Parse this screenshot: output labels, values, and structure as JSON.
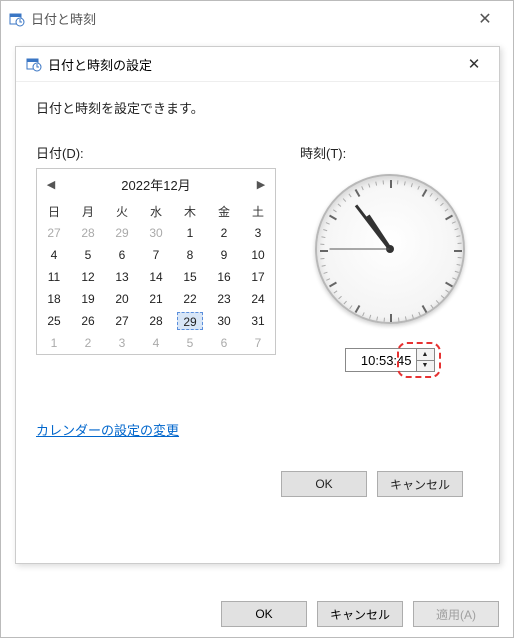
{
  "outer": {
    "title": "日付と時刻",
    "buttons": {
      "ok": "OK",
      "cancel": "キャンセル",
      "apply": "適用(A)"
    }
  },
  "inner": {
    "title": "日付と時刻の設定",
    "desc": "日付と時刻を設定できます。",
    "date_label": "日付(D):",
    "time_label": "時刻(T):",
    "calendar": {
      "month_title": "2022年12月",
      "weekdays": [
        "日",
        "月",
        "火",
        "水",
        "木",
        "金",
        "土"
      ],
      "weeks": [
        [
          {
            "d": 27,
            "o": true
          },
          {
            "d": 28,
            "o": true
          },
          {
            "d": 29,
            "o": true
          },
          {
            "d": 30,
            "o": true
          },
          {
            "d": 1
          },
          {
            "d": 2
          },
          {
            "d": 3
          }
        ],
        [
          {
            "d": 4
          },
          {
            "d": 5
          },
          {
            "d": 6
          },
          {
            "d": 7
          },
          {
            "d": 8
          },
          {
            "d": 9
          },
          {
            "d": 10
          }
        ],
        [
          {
            "d": 11
          },
          {
            "d": 12
          },
          {
            "d": 13
          },
          {
            "d": 14
          },
          {
            "d": 15
          },
          {
            "d": 16
          },
          {
            "d": 17
          }
        ],
        [
          {
            "d": 18
          },
          {
            "d": 19
          },
          {
            "d": 20
          },
          {
            "d": 21
          },
          {
            "d": 22
          },
          {
            "d": 23
          },
          {
            "d": 24
          }
        ],
        [
          {
            "d": 25
          },
          {
            "d": 26
          },
          {
            "d": 27
          },
          {
            "d": 28
          },
          {
            "d": 29,
            "sel": true
          },
          {
            "d": 30
          },
          {
            "d": 31
          }
        ],
        [
          {
            "d": 1,
            "o": true
          },
          {
            "d": 2,
            "o": true
          },
          {
            "d": 3,
            "o": true
          },
          {
            "d": 4,
            "o": true
          },
          {
            "d": 5,
            "o": true
          },
          {
            "d": 6,
            "o": true
          },
          {
            "d": 7,
            "o": true
          }
        ]
      ]
    },
    "time": {
      "value": "10:53:45",
      "h": 10,
      "m": 53,
      "s": 45
    },
    "link": "カレンダーの設定の変更",
    "buttons": {
      "ok": "OK",
      "cancel": "キャンセル"
    }
  }
}
